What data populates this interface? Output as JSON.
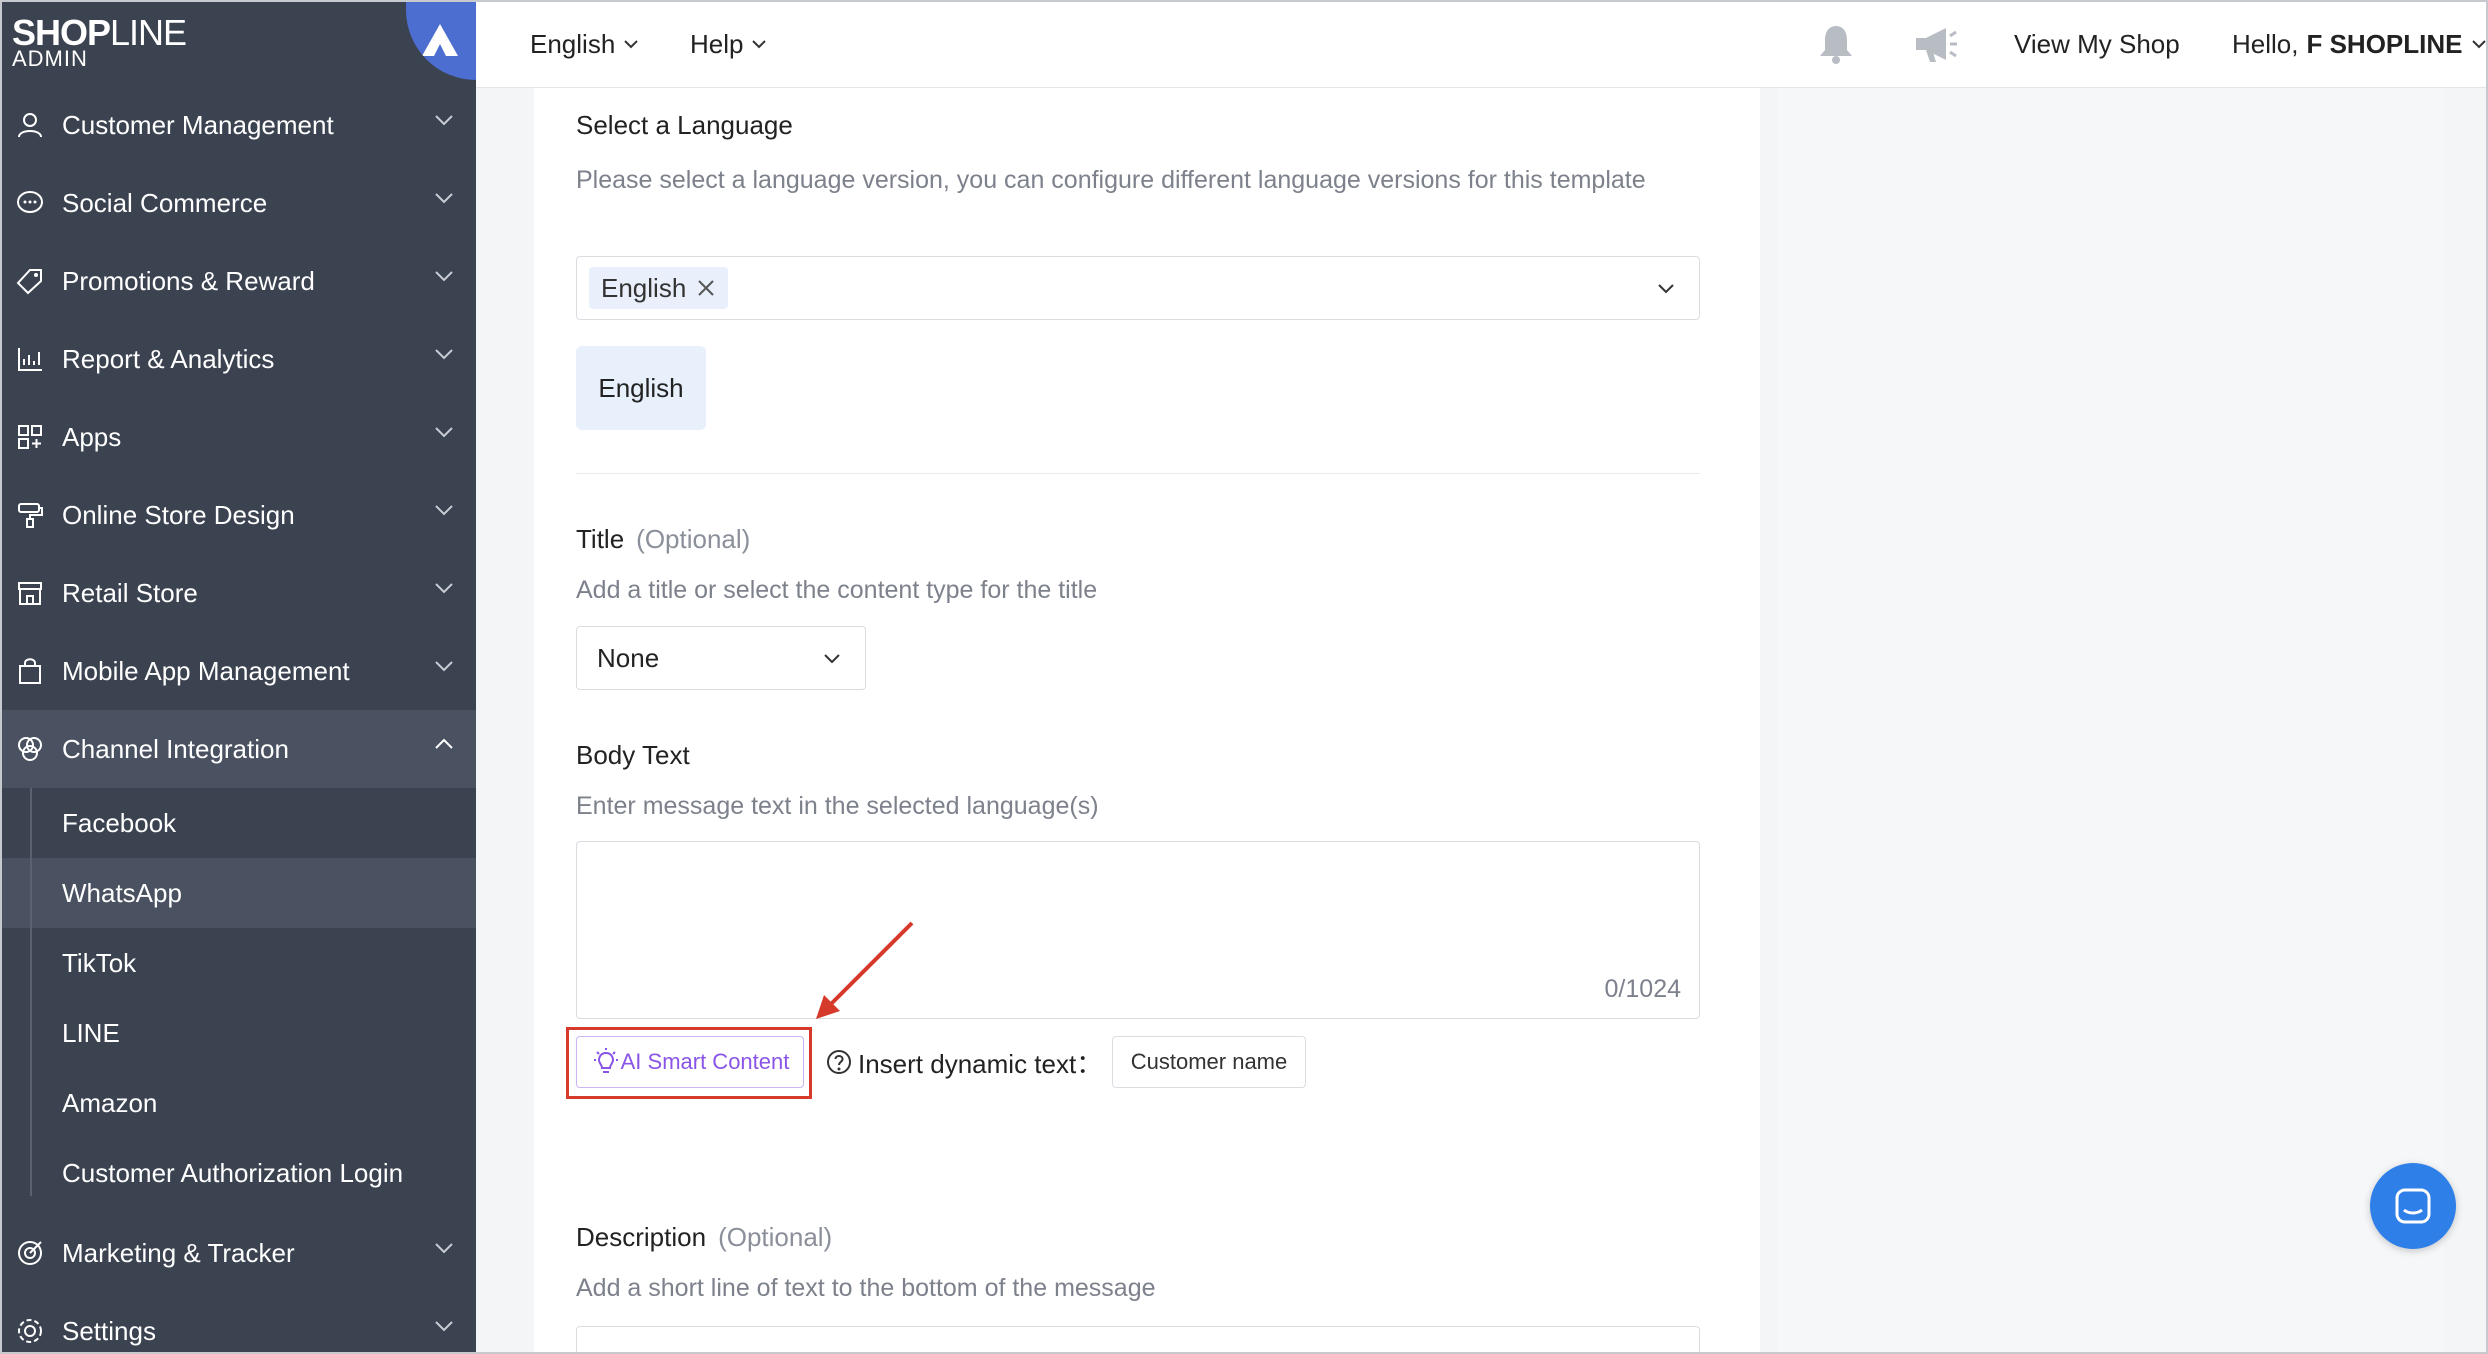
{
  "brand": {
    "logo_bold": "SHOP",
    "logo_thin": "LINE",
    "admin": "ADMIN"
  },
  "sidebar": {
    "items": [
      {
        "label": "Customer Management",
        "icon": "user-icon"
      },
      {
        "label": "Social Commerce",
        "icon": "chat-icon"
      },
      {
        "label": "Promotions & Reward",
        "icon": "tag-icon"
      },
      {
        "label": "Report & Analytics",
        "icon": "chart-icon"
      },
      {
        "label": "Apps",
        "icon": "apps-icon"
      },
      {
        "label": "Online Store Design",
        "icon": "paint-roller-icon"
      },
      {
        "label": "Retail Store",
        "icon": "store-icon"
      },
      {
        "label": "Mobile App Management",
        "icon": "bag-icon"
      },
      {
        "label": "Channel Integration",
        "icon": "channels-icon"
      },
      {
        "label": "Marketing & Tracker",
        "icon": "target-icon"
      },
      {
        "label": "Settings",
        "icon": "gear-icon"
      }
    ],
    "sub_items": [
      "Facebook",
      "WhatsApp",
      "TikTok",
      "LINE",
      "Amazon",
      "Customer Authorization Login"
    ]
  },
  "topbar": {
    "language": "English",
    "help": "Help",
    "view_shop": "View My Shop",
    "hello": "Hello,",
    "user": "F SHOPLINE"
  },
  "form": {
    "language_section": {
      "label": "Select a Language",
      "help": "Please select a language version, you can configure different language versions for this template",
      "selected_tag": "English",
      "language_button": "English"
    },
    "title_section": {
      "label": "Title",
      "optional": "(Optional)",
      "help": "Add a title or select the content type for the title",
      "select_value": "None"
    },
    "body_section": {
      "label": "Body Text",
      "help": "Enter message text in the selected language(s)",
      "counter": "0/1024",
      "ai_button": "AI Smart Content",
      "insert_label": "Insert dynamic text：",
      "chip": "Customer name"
    },
    "description_section": {
      "label": "Description",
      "optional": "(Optional)",
      "help": "Add a short line of text to the bottom of the message"
    }
  },
  "colors": {
    "sidebar": "#3b4250",
    "accent": "#4d6ed1",
    "highlight": "#d53a2b",
    "ai": "#8a55e6"
  }
}
